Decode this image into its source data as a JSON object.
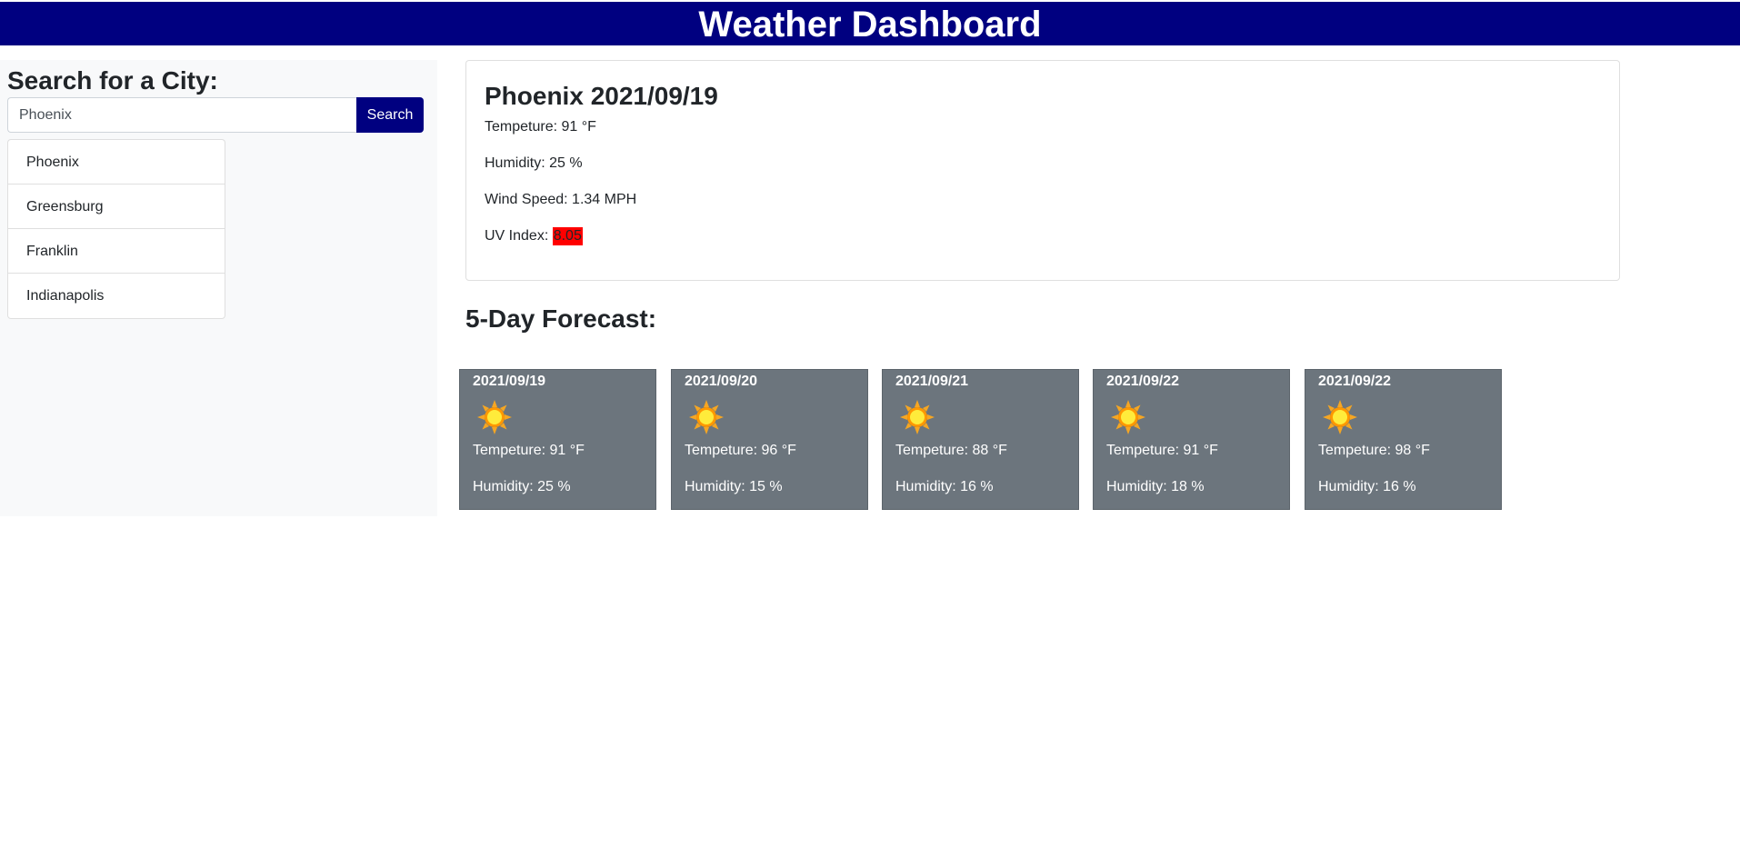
{
  "header": {
    "title": "Weather Dashboard"
  },
  "sidebar": {
    "title": "Search for a City:",
    "search": {
      "value": "Phoenix",
      "placeholder": "",
      "button_label": "Search"
    },
    "history": [
      "Phoenix",
      "Greensburg",
      "Franklin",
      "Indianapolis"
    ]
  },
  "current": {
    "title": "Phoenix 2021/09/19",
    "temperature": "Tempeture: 91 °F",
    "humidity": "Humidity: 25 %",
    "wind": "Wind Speed: 1.34 MPH",
    "uv_label": "UV Index: ",
    "uv_value": "8.05",
    "uv_color": "#ff0000"
  },
  "forecast": {
    "heading": "5-Day Forecast:",
    "days": [
      {
        "date": "2021/09/19",
        "icon": "sun-icon",
        "temp": "Tempeture: 91 °F",
        "humidity": "Humidity: 25 %"
      },
      {
        "date": "2021/09/20",
        "icon": "sun-icon",
        "temp": "Tempeture: 96 °F",
        "humidity": "Humidity: 15 %"
      },
      {
        "date": "2021/09/21",
        "icon": "sun-icon",
        "temp": "Tempeture: 88 °F",
        "humidity": "Humidity: 16 %"
      },
      {
        "date": "2021/09/22",
        "icon": "sun-icon",
        "temp": "Tempeture: 91 °F",
        "humidity": "Humidity: 18 %"
      },
      {
        "date": "2021/09/22",
        "icon": "sun-icon",
        "temp": "Tempeture: 98 °F",
        "humidity": "Humidity: 16 %"
      }
    ]
  },
  "colors": {
    "header_bg": "#000080",
    "forecast_card_bg": "#6c757d",
    "sidebar_bg": "#f8f9fa"
  }
}
